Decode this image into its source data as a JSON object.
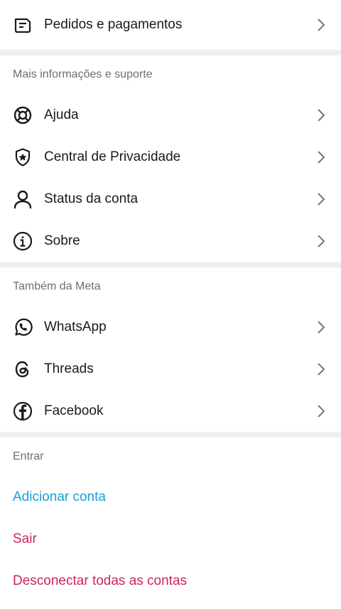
{
  "top": {
    "orders_label": "Pedidos e pagamentos"
  },
  "support": {
    "header": "Mais informações e suporte",
    "items": [
      {
        "label": "Ajuda",
        "icon": "lifebuoy-icon"
      },
      {
        "label": "Central de Privacidade",
        "icon": "shield-star-icon"
      },
      {
        "label": "Status da conta",
        "icon": "person-icon"
      },
      {
        "label": "Sobre",
        "icon": "info-icon"
      }
    ]
  },
  "meta": {
    "header": "Também da Meta",
    "items": [
      {
        "label": "WhatsApp",
        "icon": "whatsapp-icon"
      },
      {
        "label": "Threads",
        "icon": "threads-icon"
      },
      {
        "label": "Facebook",
        "icon": "facebook-icon"
      }
    ]
  },
  "login": {
    "header": "Entrar",
    "add_account": "Adicionar conta",
    "logout": "Sair",
    "logout_all": "Desconectar todas as contas"
  },
  "colors": {
    "link_blue": "#1a9ed8",
    "danger_red": "#cc2366",
    "separator": "#efefef"
  }
}
